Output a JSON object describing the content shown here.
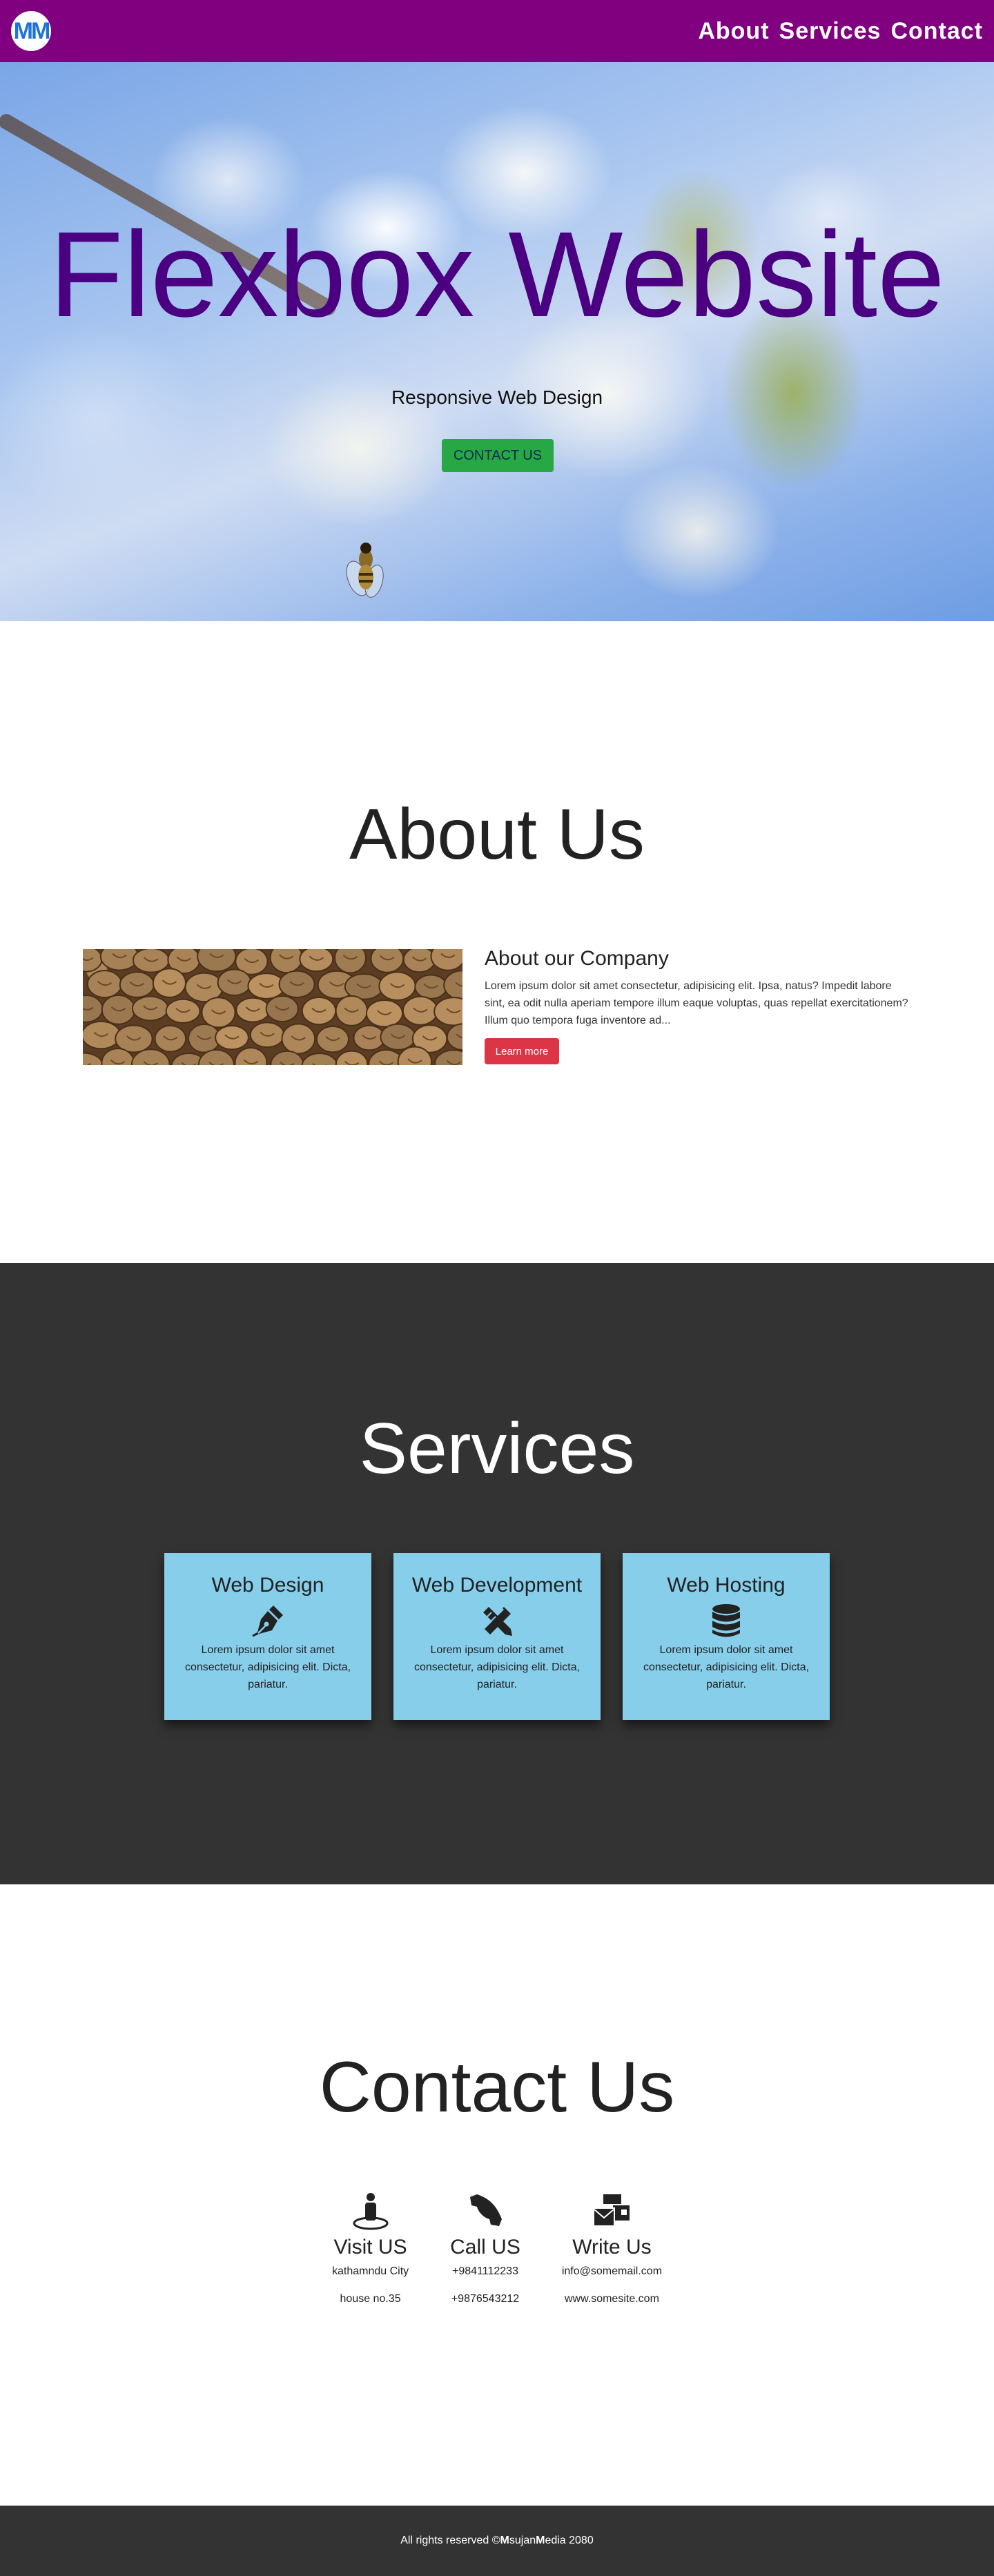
{
  "nav": {
    "logo_text": "MM",
    "links": [
      "About",
      "Services",
      "Contact"
    ]
  },
  "hero": {
    "title": "Flexbox Website",
    "subtitle": "Responsive Web Design",
    "button_label": "CONTACT US"
  },
  "about": {
    "title": "About Us",
    "heading": "About our Company",
    "text": "Lorem ipsum dolor sit amet consectetur, adipisicing elit. Ipsa, natus? Impedit labore sint, ea odit nulla aperiam tempore illum eaque voluptas, quas repellat exercitationem? Illum quo tempora fuga inventore ad...",
    "button_label": "Learn more"
  },
  "services": {
    "title": "Services",
    "cards": [
      {
        "title": "Web Design",
        "icon": "pen-nib-icon",
        "text": "Lorem ipsum dolor sit amet consectetur, adipisicing elit. Dicta, pariatur."
      },
      {
        "title": "Web Development",
        "icon": "tools-icon",
        "text": "Lorem ipsum dolor sit amet consectetur, adipisicing elit. Dicta, pariatur."
      },
      {
        "title": "Web Hosting",
        "icon": "database-icon",
        "text": "Lorem ipsum dolor sit amet consectetur, adipisicing elit. Dicta, pariatur."
      }
    ]
  },
  "contact": {
    "title": "Contact Us",
    "columns": [
      {
        "title": "Visit US",
        "icon": "location-person-icon",
        "line1": "kathamndu City",
        "line2": "house no.35"
      },
      {
        "title": "Call US",
        "icon": "phone-icon",
        "line1": "+9841112233",
        "line2": "+9876543212"
      },
      {
        "title": "Write Us",
        "icon": "mail-bulk-icon",
        "line1": "info@somemail.com",
        "line2": "www.somesite.com"
      }
    ]
  },
  "footer": {
    "prefix": "All rights reserved ©",
    "brand1_initial": "M",
    "brand1_rest": "sujan ",
    "brand2_initial": "M",
    "brand2_rest": "edia 2080"
  },
  "colors": {
    "nav_bg": "#800080",
    "hero_title": "#4b0082",
    "contact_button": "#28a745",
    "learn_button": "#dc3545",
    "services_bg": "#333333",
    "card_bg": "#87ceeb"
  }
}
